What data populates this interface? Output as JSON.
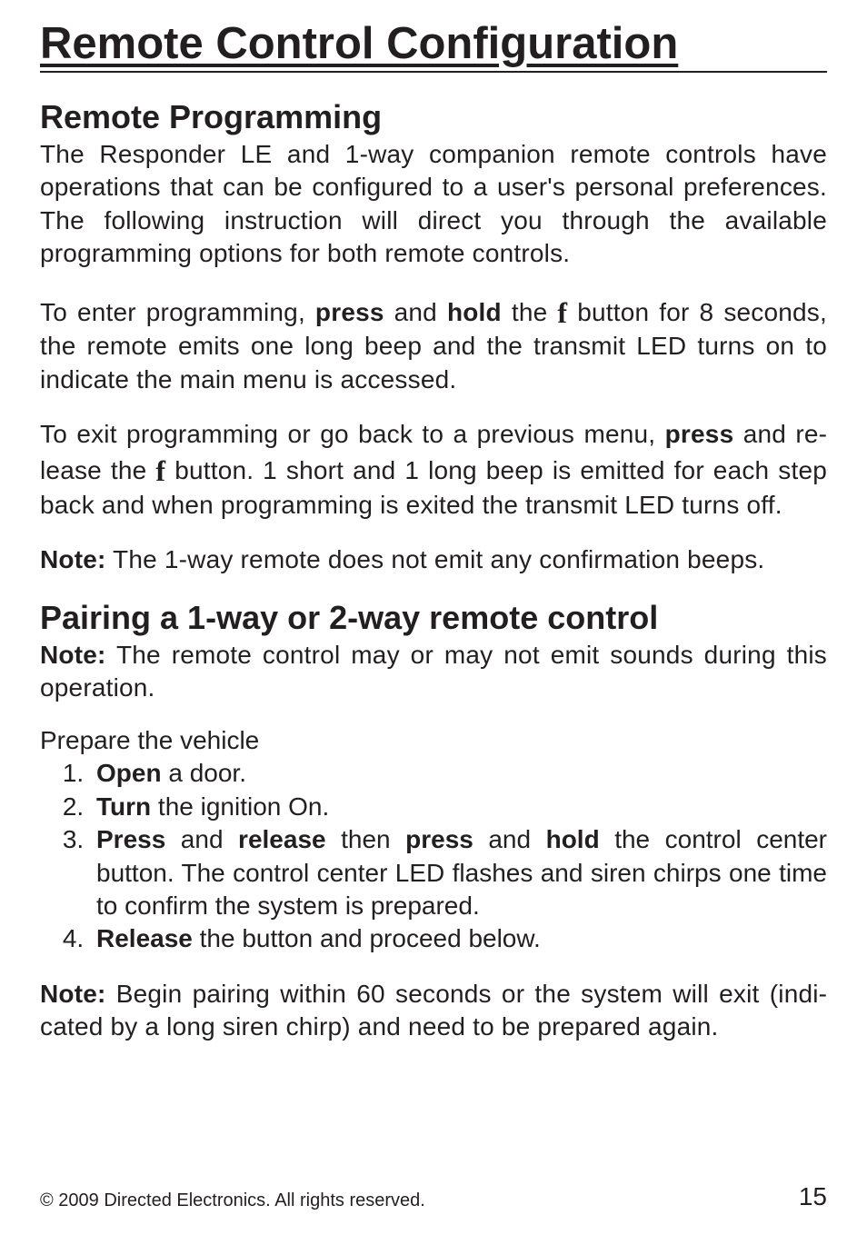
{
  "title": "Remote Control Configuration",
  "section1": {
    "heading": "Remote Programming",
    "p1": "The Responder LE and 1-way companion remote controls have opera­tions that can be configured to a user's personal preferences. The fol­lowing instruction will direct you through the available programming options for both remote controls.",
    "p2_pre": "To enter programming, ",
    "p2_b1": "press",
    "p2_mid1": " and ",
    "p2_b2": "hold",
    "p2_mid2": " the ",
    "p2_icon": "f",
    "p2_post": " button for 8 seconds, the remote emits one long beep and the transmit LED turns on to indi­cate the main menu is accessed.",
    "p3_pre": "To exit programming or go back to a previous menu, ",
    "p3_b1": "press",
    "p3_mid1": " and re­lease the ",
    "p3_icon": "f",
    "p3_post": " button. 1 short and 1 long beep is emitted for each step back and when programming is exited the transmit LED turns off.",
    "note_label": "Note:",
    "note_text": " The 1-way remote does not emit any confirmation beeps."
  },
  "section2": {
    "heading": "Pairing a 1-way or 2-way remote control",
    "note_label": "Note:",
    "note_text": " The remote control may or may not emit sounds during this operation.",
    "sub_heading": "Prepare the vehicle",
    "steps": {
      "s1_b": "Open",
      "s1_t": " a door.",
      "s2_b": "Turn",
      "s2_t": " the ignition On.",
      "s3_b1": "Press",
      "s3_t1": " and ",
      "s3_b2": "release",
      "s3_t2": " then ",
      "s3_b3": "press",
      "s3_t3": " and ",
      "s3_b4": "hold",
      "s3_t4": " the control center button. The control center LED flashes and siren chirps one time to con­firm the system is prepared.",
      "s4_b": "Release",
      "s4_t": " the button and proceed below."
    },
    "note2_label": "Note:",
    "note2_text": " Begin pairing within 60 seconds or the system will exit (indi­cated by a long siren chirp) and need to be prepared again."
  },
  "footer": {
    "copyright": "© 2009 Directed Electronics. All rights reserved.",
    "page": "15"
  }
}
